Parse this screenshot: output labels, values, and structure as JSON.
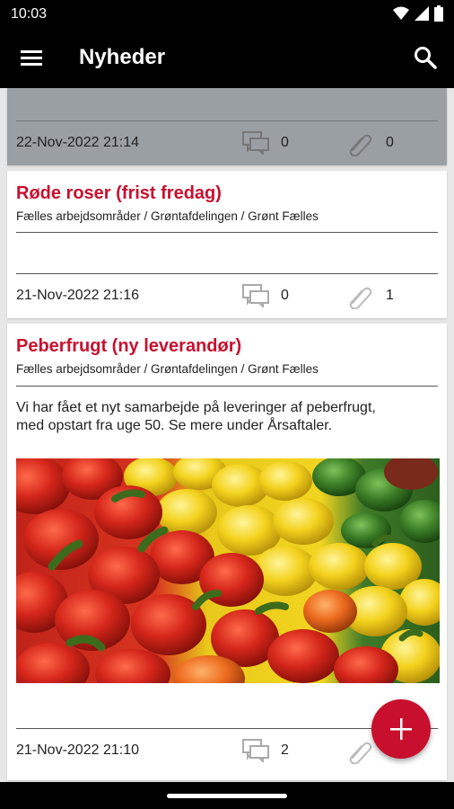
{
  "status_bar": {
    "time": "10:03"
  },
  "app_bar": {
    "title": "Nyheder"
  },
  "posts": [
    {
      "title": "",
      "path": "",
      "date": "22-Nov-2022 21:14",
      "comments": "0",
      "attachments": "0"
    },
    {
      "title": "Røde roser (frist fredag)",
      "path": "Fælles arbejdsområder / Grøntafdelingen / Grønt Fælles",
      "date": "21-Nov-2022 21:16",
      "comments": "0",
      "attachments": "1"
    },
    {
      "title": "Peberfrugt (ny leverandør)",
      "path": "Fælles arbejdsområder / Grøntafdelingen / Grønt Fælles",
      "body_line1": "Vi har fået et nyt samarbejde på leveringer af peberfrugt,",
      "body_line2": "med opstart fra uge 50. Se mere under Årsaftaler.",
      "image": "bell-peppers-photo",
      "date": "21-Nov-2022 21:10",
      "comments": "2",
      "attachments": ""
    }
  ],
  "fab": {
    "icon": "plus-icon"
  },
  "colors": {
    "accent": "#c8102e",
    "app_bar": "#000000"
  }
}
